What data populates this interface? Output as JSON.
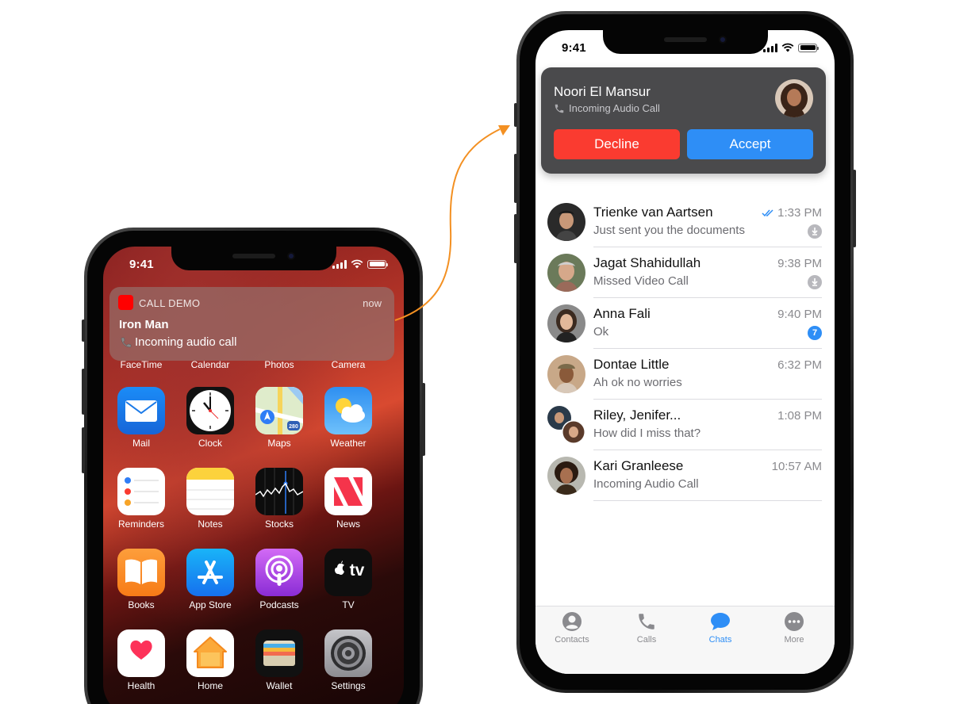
{
  "left_phone": {
    "status_time": "9:41",
    "notification": {
      "app_name": "CALL DEMO",
      "time": "now",
      "title": "Iron Man",
      "body": "Incoming audio call"
    },
    "partial_row_labels": [
      "FaceTime",
      "Calendar",
      "Photos",
      "Camera"
    ],
    "apps": [
      {
        "label": "Mail"
      },
      {
        "label": "Clock"
      },
      {
        "label": "Maps"
      },
      {
        "label": "Weather"
      },
      {
        "label": "Reminders"
      },
      {
        "label": "Notes"
      },
      {
        "label": "Stocks"
      },
      {
        "label": "News"
      },
      {
        "label": "Books"
      },
      {
        "label": "App Store"
      },
      {
        "label": "Podcasts"
      },
      {
        "label": "TV"
      },
      {
        "label": "Health"
      },
      {
        "label": "Home"
      },
      {
        "label": "Wallet"
      },
      {
        "label": "Settings"
      }
    ],
    "maps_shield": "280",
    "tv_text": "tv"
  },
  "right_phone": {
    "status_time": "9:41",
    "incoming_call": {
      "caller": "Noori El Mansur",
      "subtitle": "Incoming Audio Call",
      "decline_label": "Decline",
      "accept_label": "Accept"
    },
    "chats": [
      {
        "name": "Trienke van Aartsen",
        "message": "Just sent you the documents",
        "time": "1:33 PM",
        "read": true,
        "badge": "pin"
      },
      {
        "name": "Jagat Shahidullah",
        "message": "Missed Video Call",
        "time": "9:38 PM",
        "badge": "pin"
      },
      {
        "name": "Anna Fali",
        "message": "Ok",
        "time": "9:40 PM",
        "badge": "count",
        "count": "7"
      },
      {
        "name": "Dontae Little",
        "message": "Ah ok no worries",
        "time": "6:32 PM"
      },
      {
        "name": "Riley, Jenifer...",
        "message": "How did I miss that?",
        "time": "1:08 PM",
        "group": true
      },
      {
        "name": "Kari Granleese",
        "message": "Incoming Audio Call",
        "time": "10:57 AM"
      }
    ],
    "tabs": [
      {
        "label": "Contacts",
        "icon": "contacts-icon"
      },
      {
        "label": "Calls",
        "icon": "phone-icon"
      },
      {
        "label": "Chats",
        "icon": "chat-bubble-icon",
        "active": true
      },
      {
        "label": "More",
        "icon": "more-icon"
      }
    ]
  },
  "colors": {
    "accent_blue": "#2e8ef6",
    "decline_red": "#fa3b30",
    "arrow_orange": "#f39022"
  }
}
